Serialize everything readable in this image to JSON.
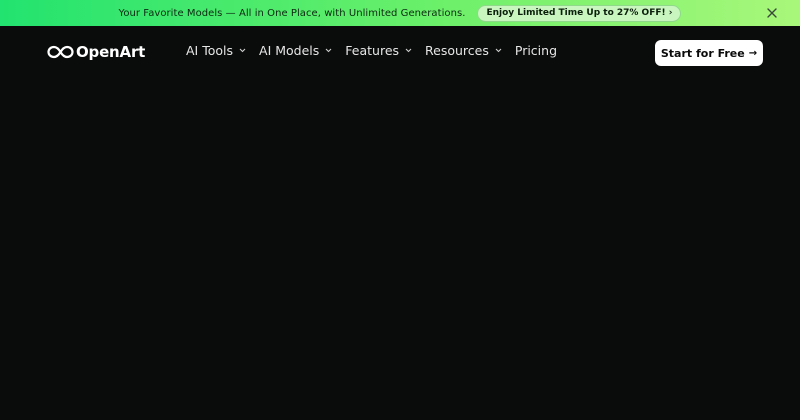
{
  "banner": {
    "text": "Your Favorite Models — All in One Place, with Unlimited Generations.",
    "cta_label": "Enjoy Limited Time Up to 27% OFF! ›",
    "close_icon": "close-icon"
  },
  "nav": {
    "logo_text": "OpenArt",
    "logo_icon": "infinity-logo-icon",
    "items": [
      {
        "label": "AI Tools",
        "has_dropdown": true
      },
      {
        "label": "AI Models",
        "has_dropdown": true
      },
      {
        "label": "Features",
        "has_dropdown": true
      },
      {
        "label": "Resources",
        "has_dropdown": true
      },
      {
        "label": "Pricing",
        "has_dropdown": false
      }
    ],
    "cta_label": "Start for Free",
    "cta_arrow": "→"
  },
  "colors": {
    "background": "#0a0b0b",
    "banner_gradient_start": "#22e36f",
    "banner_gradient_end": "#a9f77a",
    "cta_bg": "#ffffff"
  }
}
